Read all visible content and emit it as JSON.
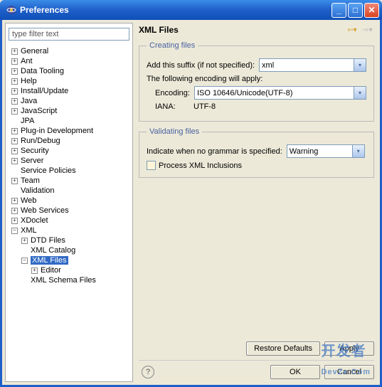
{
  "window": {
    "title": "Preferences"
  },
  "filter": {
    "placeholder": "type filter text"
  },
  "tree": {
    "items": [
      {
        "label": "General",
        "exp": "+",
        "indent": 0
      },
      {
        "label": "Ant",
        "exp": "+",
        "indent": 0
      },
      {
        "label": "Data Tooling",
        "exp": "+",
        "indent": 0
      },
      {
        "label": "Help",
        "exp": "+",
        "indent": 0
      },
      {
        "label": "Install/Update",
        "exp": "+",
        "indent": 0
      },
      {
        "label": "Java",
        "exp": "+",
        "indent": 0
      },
      {
        "label": "JavaScript",
        "exp": "+",
        "indent": 0
      },
      {
        "label": "JPA",
        "exp": "",
        "indent": 0
      },
      {
        "label": "Plug-in Development",
        "exp": "+",
        "indent": 0
      },
      {
        "label": "Run/Debug",
        "exp": "+",
        "indent": 0
      },
      {
        "label": "Security",
        "exp": "+",
        "indent": 0
      },
      {
        "label": "Server",
        "exp": "+",
        "indent": 0
      },
      {
        "label": "Service Policies",
        "exp": "",
        "indent": 0
      },
      {
        "label": "Team",
        "exp": "+",
        "indent": 0
      },
      {
        "label": "Validation",
        "exp": "",
        "indent": 0
      },
      {
        "label": "Web",
        "exp": "+",
        "indent": 0
      },
      {
        "label": "Web Services",
        "exp": "+",
        "indent": 0
      },
      {
        "label": "XDoclet",
        "exp": "+",
        "indent": 0
      },
      {
        "label": "XML",
        "exp": "−",
        "indent": 0
      },
      {
        "label": "DTD Files",
        "exp": "+",
        "indent": 1
      },
      {
        "label": "XML Catalog",
        "exp": "",
        "indent": 1
      },
      {
        "label": "XML Files",
        "exp": "−",
        "indent": 1,
        "selected": true
      },
      {
        "label": "Editor",
        "exp": "+",
        "indent": 2
      },
      {
        "label": "XML Schema Files",
        "exp": "",
        "indent": 1
      }
    ]
  },
  "page": {
    "title": "XML Files",
    "creating": {
      "legend": "Creating files",
      "suffix_label": "Add this suffix (if not specified):",
      "suffix_value": "xml",
      "encoding_note": "The following encoding will apply:",
      "encoding_label": "Encoding:",
      "encoding_value": "ISO 10646/Unicode(UTF-8)",
      "iana_label": "IANA:",
      "iana_value": "UTF-8"
    },
    "validating": {
      "legend": "Validating files",
      "grammar_label": "Indicate when no grammar is specified:",
      "grammar_value": "Warning",
      "inclusions_label": "Process XML Inclusions"
    }
  },
  "buttons": {
    "restore": "Restore Defaults",
    "apply": "Apply",
    "ok": "OK",
    "cancel": "Cancel"
  },
  "watermark": {
    "cn": "开发者",
    "en": "DevZe.Com"
  }
}
